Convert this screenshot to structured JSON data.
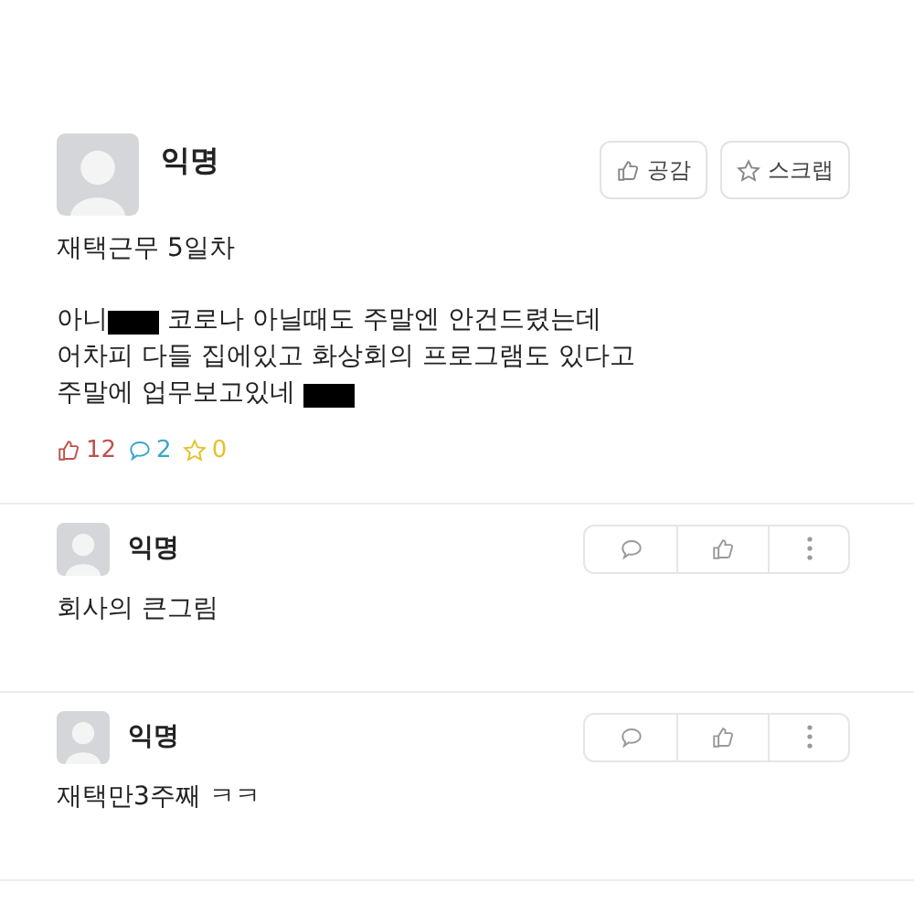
{
  "post": {
    "author": "익명",
    "actions": [
      "공감",
      "스크랩"
    ],
    "title": "재택근무 5일차",
    "body": [
      [
        {
          "kind": "text",
          "text": "아니"
        },
        {
          "kind": "redacted"
        },
        {
          "kind": "text",
          "text": " 코로나 아닐때도 주말엔 안건드렸는데"
        }
      ],
      [
        {
          "kind": "text",
          "text": "어차피 다들 집에있고 화상회의 프로그램도 있다고"
        }
      ],
      [
        {
          "kind": "text",
          "text": "주말에 업무보고있네 "
        },
        {
          "kind": "redacted"
        }
      ]
    ],
    "stats": [
      {
        "kind": "like",
        "count": "12"
      },
      {
        "kind": "comment",
        "count": "2"
      },
      {
        "kind": "scrap",
        "count": "0"
      }
    ]
  },
  "comments": [
    {
      "author": "익명",
      "text": "회사의 큰그림"
    },
    {
      "author": "익명",
      "text": "재택만3주째 ㅋㅋ"
    }
  ]
}
